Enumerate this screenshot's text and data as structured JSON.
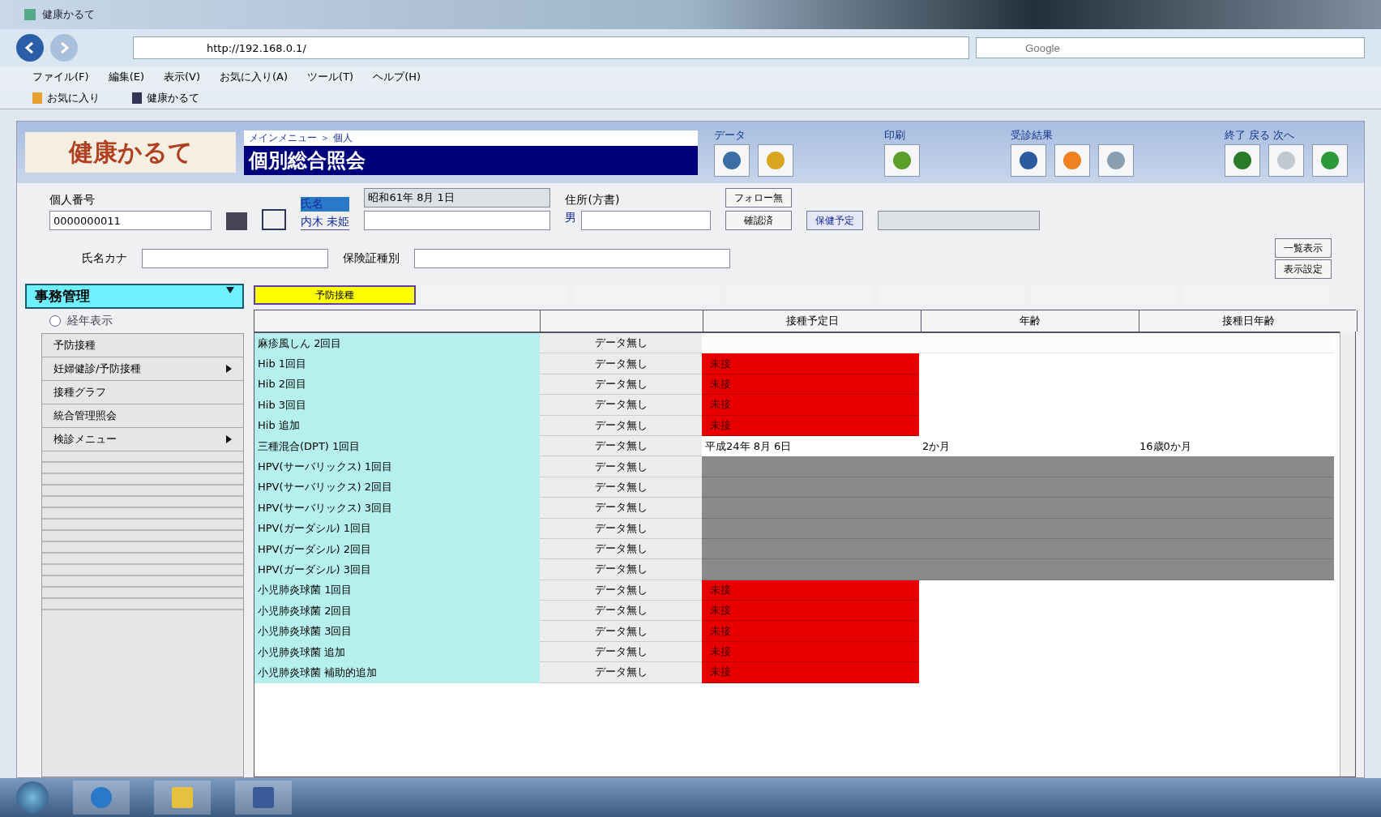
{
  "window": {
    "title": "健康かるて",
    "address": "http://192.168.0.1/",
    "search_placeholder": "Google"
  },
  "menu": [
    "ファイル(F)",
    "編集(E)",
    "表示(V)",
    "お気に入り(A)",
    "ツール(T)",
    "ヘルプ(H)"
  ],
  "favorites": [
    "お気に入り",
    "健康かるて"
  ],
  "header": {
    "logo": "健康かるて",
    "breadcrumb": "メインメニュー ＞ 個人",
    "title": "個別総合照会",
    "tool_groups": [
      {
        "label": "データ"
      },
      {
        "label": "印刷"
      },
      {
        "label": "受診結果"
      },
      {
        "label": "終了 戻る 次へ"
      }
    ]
  },
  "form": {
    "id_label": "個人番号",
    "id_value": "0000000011",
    "name_label": "氏名",
    "name_value": "内木 未姫",
    "birth": "昭和61年 8月 1日",
    "address_label": "住所(方書)",
    "sex": "男",
    "follow_buttons": [
      "フォロー無",
      "確認済"
    ],
    "plan_label": "保健予定",
    "kana_label": "氏名カナ",
    "insurance_label": "保険証種別",
    "side_buttons": [
      "一覧表示",
      "表示設定"
    ]
  },
  "sidebar": {
    "dropdown": "事務管理",
    "radio": {
      "label": "経年表示",
      "selected": false
    },
    "items": [
      {
        "label": "予防接種",
        "submenu": false
      },
      {
        "label": "妊婦健診/予防接種",
        "submenu": true
      },
      {
        "label": "接種グラフ",
        "submenu": false
      },
      {
        "label": "統合管理照会",
        "submenu": false
      },
      {
        "label": "検診メニュー",
        "submenu": true
      }
    ]
  },
  "tabs": [
    {
      "label": "予防接種",
      "selected": true
    }
  ],
  "table": {
    "columns": [
      "接種予定日",
      "年齢",
      "接種日年齢"
    ],
    "rows": [
      {
        "name": "麻疹風しん 2回目",
        "status": "データ無し",
        "kind": "empty"
      },
      {
        "name": "Hib 1回目",
        "status": "データ無し",
        "kind": "overdue",
        "mark": "未接"
      },
      {
        "name": "Hib 2回目",
        "status": "データ無し",
        "kind": "overdue",
        "mark": "未接"
      },
      {
        "name": "Hib 3回目",
        "status": "データ無し",
        "kind": "overdue",
        "mark": "未接"
      },
      {
        "name": "Hib 追加",
        "status": "データ無し",
        "kind": "overdue",
        "mark": "未接"
      },
      {
        "name": "三種混合(DPT) 1回目",
        "status": "データ無し",
        "kind": "scheduled",
        "date": "平成24年 8月 6日",
        "age": "2か月",
        "age_at": "16歳0か月"
      },
      {
        "name": "HPV(サーバリックス) 1回目",
        "status": "データ無し",
        "kind": "na"
      },
      {
        "name": "HPV(サーバリックス) 2回目",
        "status": "データ無し",
        "kind": "na"
      },
      {
        "name": "HPV(サーバリックス) 3回目",
        "status": "データ無し",
        "kind": "na"
      },
      {
        "name": "HPV(ガーダシル) 1回目",
        "status": "データ無し",
        "kind": "na"
      },
      {
        "name": "HPV(ガーダシル) 2回目",
        "status": "データ無し",
        "kind": "na"
      },
      {
        "name": "HPV(ガーダシル) 3回目",
        "status": "データ無し",
        "kind": "na"
      },
      {
        "name": "小児肺炎球菌 1回目",
        "status": "データ無し",
        "kind": "overdue",
        "mark": "未接"
      },
      {
        "name": "小児肺炎球菌 2回目",
        "status": "データ無し",
        "kind": "overdue",
        "mark": "未接"
      },
      {
        "name": "小児肺炎球菌 3回目",
        "status": "データ無し",
        "kind": "overdue",
        "mark": "未接"
      },
      {
        "name": "小児肺炎球菌 追加",
        "status": "データ無し",
        "kind": "overdue",
        "mark": "未接"
      },
      {
        "name": "小児肺炎球菌 補助的追加",
        "status": "データ無し",
        "kind": "overdue",
        "mark": "未接"
      }
    ]
  }
}
